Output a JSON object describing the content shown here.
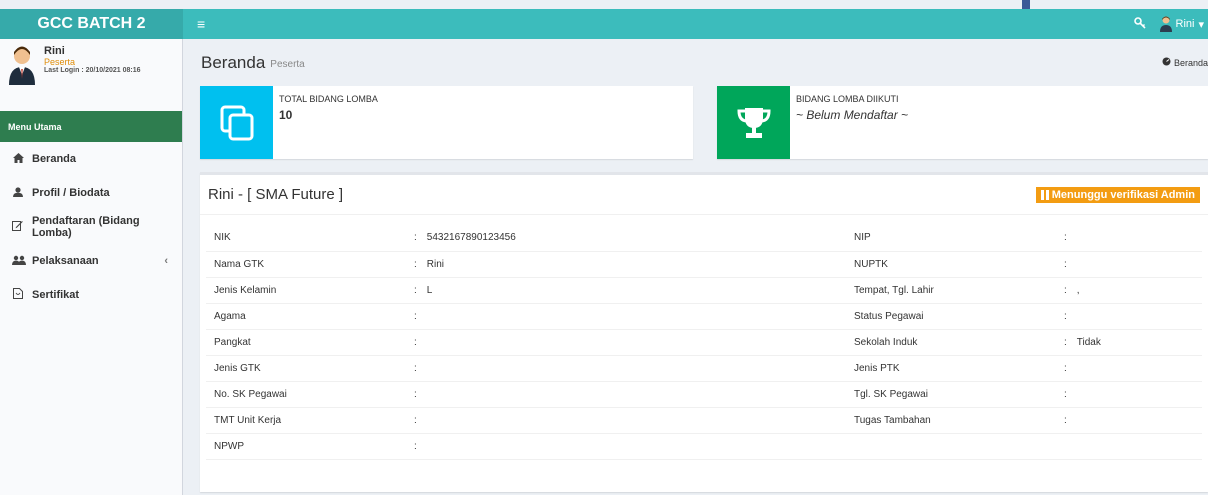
{
  "header": {
    "app_title": "GCC BATCH 2",
    "menu_toggle": "≡",
    "key_icon": "key-icon",
    "user_name": "Rini",
    "user_caret": "▾"
  },
  "sidebar": {
    "user": {
      "name": "Rini",
      "role": "Peserta",
      "last_login": "Last Login : 20/10/2021 08:16"
    },
    "menu_header": "Menu Utama",
    "items": [
      {
        "label": "Beranda",
        "icon": "home-icon"
      },
      {
        "label": "Profil / Biodata",
        "icon": "user-icon"
      },
      {
        "label": "Pendaftaran (Bidang Lomba)",
        "icon": "edit-icon"
      },
      {
        "label": "Pelaksanaan",
        "icon": "group-icon",
        "caret": "‹"
      },
      {
        "label": "Sertifikat",
        "icon": "file-icon"
      }
    ]
  },
  "content": {
    "title": "Beranda",
    "subtitle": "Peserta",
    "breadcrumb": "Beranda"
  },
  "info_boxes": [
    {
      "label": "TOTAL BIDANG LOMBA",
      "value": "10",
      "color": "#00c0ef",
      "icon": "copy-icon"
    },
    {
      "label": "BIDANG LOMBA DIIKUTI",
      "value": "~ Belum Mendaftar ~",
      "color": "#00a65a",
      "icon": "trophy-icon"
    }
  ],
  "profile": {
    "title": "Rini - [ SMA Future ]",
    "status": "Menunggu verifikasi Admin",
    "rows": [
      {
        "l1": "NIK",
        "v1": "5432167890123456",
        "l2": "NIP",
        "v2": ""
      },
      {
        "l1": "Nama GTK",
        "v1": "Rini",
        "l2": "NUPTK",
        "v2": ""
      },
      {
        "l1": "Jenis Kelamin",
        "v1": "L",
        "l2": "Tempat, Tgl. Lahir",
        "v2": ","
      },
      {
        "l1": "Agama",
        "v1": "",
        "l2": "Status Pegawai",
        "v2": ""
      },
      {
        "l1": "Pangkat",
        "v1": "",
        "l2": "Sekolah Induk",
        "v2": "Tidak"
      },
      {
        "l1": "Jenis GTK",
        "v1": "",
        "l2": "Jenis PTK",
        "v2": ""
      },
      {
        "l1": "No. SK Pegawai",
        "v1": "",
        "l2": "Tgl. SK Pegawai",
        "v2": ""
      },
      {
        "l1": "TMT Unit Kerja",
        "v1": "",
        "l2": "Tugas Tambahan",
        "v2": ""
      },
      {
        "l1": "NPWP",
        "v1": "",
        "l2": "",
        "v2": ""
      }
    ]
  },
  "colors": {
    "header": "#3cbcbc",
    "menu_header": "#2e7d4f",
    "status": "#f39c12"
  }
}
